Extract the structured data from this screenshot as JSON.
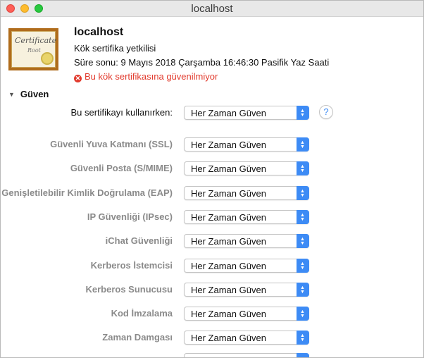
{
  "window": {
    "title": "localhost"
  },
  "certificate": {
    "icon": "certificate-icon",
    "icon_text": "Certificate",
    "icon_subtext": "Root",
    "name": "localhost",
    "type": "Kök sertifika yetkilisi",
    "expiry": "Süre sonu: 9 Mayıs 2018 Çarşamba 16:46:30 Pasifik Yaz Saati",
    "warning": "Bu kök sertifikasına güvenilmiyor",
    "warning_icon": "error-icon",
    "warning_color": "#e23b2e"
  },
  "trust": {
    "section_label": "Güven",
    "primary_label": "Bu sertifikayı kullanırken:",
    "primary_value": "Her Zaman Güven",
    "help_label": "?",
    "rows": [
      {
        "label": "Güvenli Yuva Katmanı (SSL)",
        "value": "Her Zaman Güven"
      },
      {
        "label": "Güvenli Posta (S/MIME)",
        "value": "Her Zaman Güven"
      },
      {
        "label": "Genişletilebilir Kimlik Doğrulama (EAP)",
        "value": "Her Zaman Güven"
      },
      {
        "label": "IP Güvenliği (IPsec)",
        "value": "Her Zaman Güven"
      },
      {
        "label": "iChat Güvenliği",
        "value": "Her Zaman Güven"
      },
      {
        "label": "Kerberos İstemcisi",
        "value": "Her Zaman Güven"
      },
      {
        "label": "Kerberos Sunucusu",
        "value": "Her Zaman Güven"
      },
      {
        "label": "Kod İmzalama",
        "value": "Her Zaman Güven"
      },
      {
        "label": "Zaman Damgası",
        "value": "Her Zaman Güven"
      }
    ]
  },
  "colors": {
    "accent": "#3d8bf5",
    "close": "#fe5f57",
    "minimize": "#febc2e",
    "maximize": "#28c840"
  }
}
